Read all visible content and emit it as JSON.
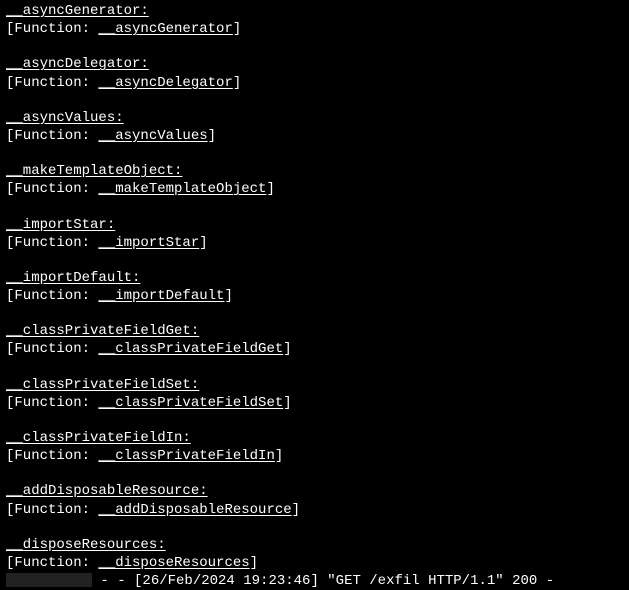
{
  "entries": [
    {
      "key": "__asyncGenerator:",
      "fn": "__asyncGenerator"
    },
    {
      "key": "__asyncDelegator:",
      "fn": "__asyncDelegator"
    },
    {
      "key": "__asyncValues:",
      "fn": "__asyncValues"
    },
    {
      "key": "__makeTemplateObject:",
      "fn": "__makeTemplateObject"
    },
    {
      "key": "__importStar:",
      "fn": "__importStar"
    },
    {
      "key": "__importDefault:",
      "fn": "__importDefault"
    },
    {
      "key": "__classPrivateFieldGet:",
      "fn": "__classPrivateFieldGet"
    },
    {
      "key": "__classPrivateFieldSet:",
      "fn": "__classPrivateFieldSet"
    },
    {
      "key": "__classPrivateFieldIn:",
      "fn": "__classPrivateFieldIn"
    },
    {
      "key": "__addDisposableResource:",
      "fn": "__addDisposableResource"
    },
    {
      "key": "__disposeResources:",
      "fn": "__disposeResources"
    }
  ],
  "fn_prefix": "[Function: ",
  "fn_suffix": "]",
  "log": {
    "sep": " - - ",
    "timestamp": "[26/Feb/2024 19:23:46]",
    "request": " \"GET /exfil HTTP/1.1\" 200 -"
  }
}
